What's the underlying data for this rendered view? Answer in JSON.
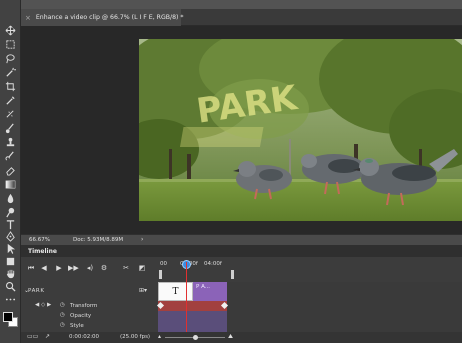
{
  "document": {
    "tab_title": "Enhance a video clip @ 66.7% (L I F E, RGB/8) *",
    "tab_close": "×"
  },
  "photo": {
    "overlay_text": "PARK"
  },
  "status": {
    "zoom": "66.67%",
    "doc_size": "Doc: 5.93M/8.89M",
    "arrow": "›"
  },
  "timeline": {
    "title": "Timeline",
    "ruler": {
      "t0": "00",
      "t1": "02:00f",
      "t2": "04:00f"
    },
    "track_name": "PARK",
    "clip_text_glyph": "T",
    "clip_park_label": "P A...",
    "properties": [
      {
        "label": "Transform"
      },
      {
        "label": "Opacity"
      },
      {
        "label": "Style"
      }
    ],
    "current_time": "0:00:02:00",
    "fps": "(25.00 fps)"
  },
  "colors": {
    "foreground": "#000000",
    "background": "#ffffff",
    "clip_purple": "#8b63b8",
    "transform_band": "#a2403f",
    "playhead": "#3a8de0"
  },
  "icons": {
    "tools": [
      "move-icon",
      "marquee-icon",
      "lasso-icon",
      "magic-wand-icon",
      "crop-icon",
      "eyedropper-icon",
      "healing-icon",
      "brush-icon",
      "stamp-icon",
      "history-brush-icon",
      "eraser-icon",
      "gradient-icon",
      "blur-icon",
      "dodge-icon",
      "pen-icon",
      "type-icon",
      "path-select-icon",
      "shape-icon",
      "hand-icon",
      "zoom-icon",
      "more-icon"
    ]
  }
}
